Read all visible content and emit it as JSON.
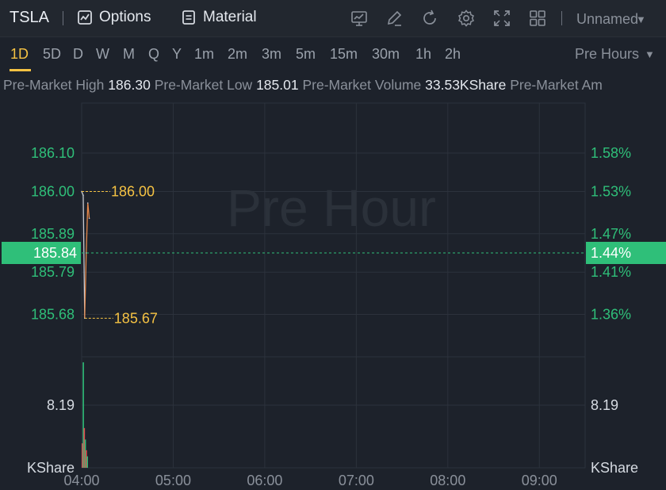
{
  "header": {
    "symbol": "TSLA",
    "options_label": "Options",
    "material_label": "Material",
    "layout_name": "Unnamed",
    "icons": [
      "chart-icon",
      "edit-icon",
      "refresh-icon",
      "settings-icon",
      "fullscreen-icon",
      "grid-layout-icon"
    ]
  },
  "periods": {
    "items": [
      "1D",
      "5D",
      "D",
      "W",
      "M",
      "Q",
      "Y",
      "1m",
      "2m",
      "3m",
      "5m",
      "15m",
      "30m",
      "1h",
      "2h"
    ],
    "active": "1D",
    "session": "Pre Hours"
  },
  "stats": {
    "high_label": "Pre-Market High",
    "high_value": "186.30",
    "low_label": "Pre-Market Low",
    "low_value": "185.01",
    "volume_label": "Pre-Market Volume",
    "volume_value": "33.53KShare",
    "amount_label": "Pre-Market Am"
  },
  "colors": {
    "background": "#1d222b",
    "up": "#2fbf79",
    "down": "#e5484d",
    "annotation": "#f5c243",
    "line": "#c7cbd3",
    "line_accent": "#e4874a"
  },
  "chart_data": {
    "type": "line",
    "watermark": "Pre Hour",
    "y_ticks": [
      "186.10",
      "186.00",
      "185.89",
      "185.79",
      "185.68"
    ],
    "y_tick_values": [
      186.1,
      186.0,
      185.89,
      185.79,
      185.68
    ],
    "right_ticks": [
      "1.58%",
      "1.53%",
      "1.47%",
      "1.41%",
      "1.36%"
    ],
    "current_price": "185.84",
    "current_pct": "1.44%",
    "current_value": 185.84,
    "annotation_high": "186.00",
    "annotation_high_value": 186.0,
    "annotation_low": "185.67",
    "annotation_low_value": 185.67,
    "x_ticks": [
      "04:00",
      "05:00",
      "06:00",
      "07:00",
      "08:00",
      "09:00"
    ],
    "x_tick_hours": [
      4,
      5,
      6,
      7,
      8,
      9
    ],
    "x_range_hours": [
      4,
      9.5
    ],
    "ylim": [
      185.58,
      186.23
    ],
    "series": [
      {
        "x": [
          "04:00",
          "04:01",
          "04:02",
          "04:03",
          "04:04",
          "04:05"
        ],
        "x_hours": [
          4.0,
          4.017,
          4.033,
          4.05,
          4.067,
          4.083
        ],
        "values": [
          186.0,
          185.99,
          185.67,
          185.84,
          185.97,
          185.93
        ]
      }
    ],
    "volume": {
      "tick_label": "8.19",
      "unit_label": "KShare",
      "right_tick_label": "8.19",
      "right_unit_label": "KShare",
      "tick_value": 8.19,
      "ylim": [
        0,
        14
      ],
      "bars": [
        {
          "x_hours": 4.0,
          "value": 3.2,
          "dir": "down"
        },
        {
          "x_hours": 4.011,
          "value": 13.8,
          "dir": "up"
        },
        {
          "x_hours": 4.022,
          "value": 5.2,
          "dir": "down"
        },
        {
          "x_hours": 4.033,
          "value": 3.7,
          "dir": "up"
        },
        {
          "x_hours": 4.044,
          "value": 2.3,
          "dir": "down"
        },
        {
          "x_hours": 4.055,
          "value": 1.5,
          "dir": "up"
        }
      ]
    }
  }
}
